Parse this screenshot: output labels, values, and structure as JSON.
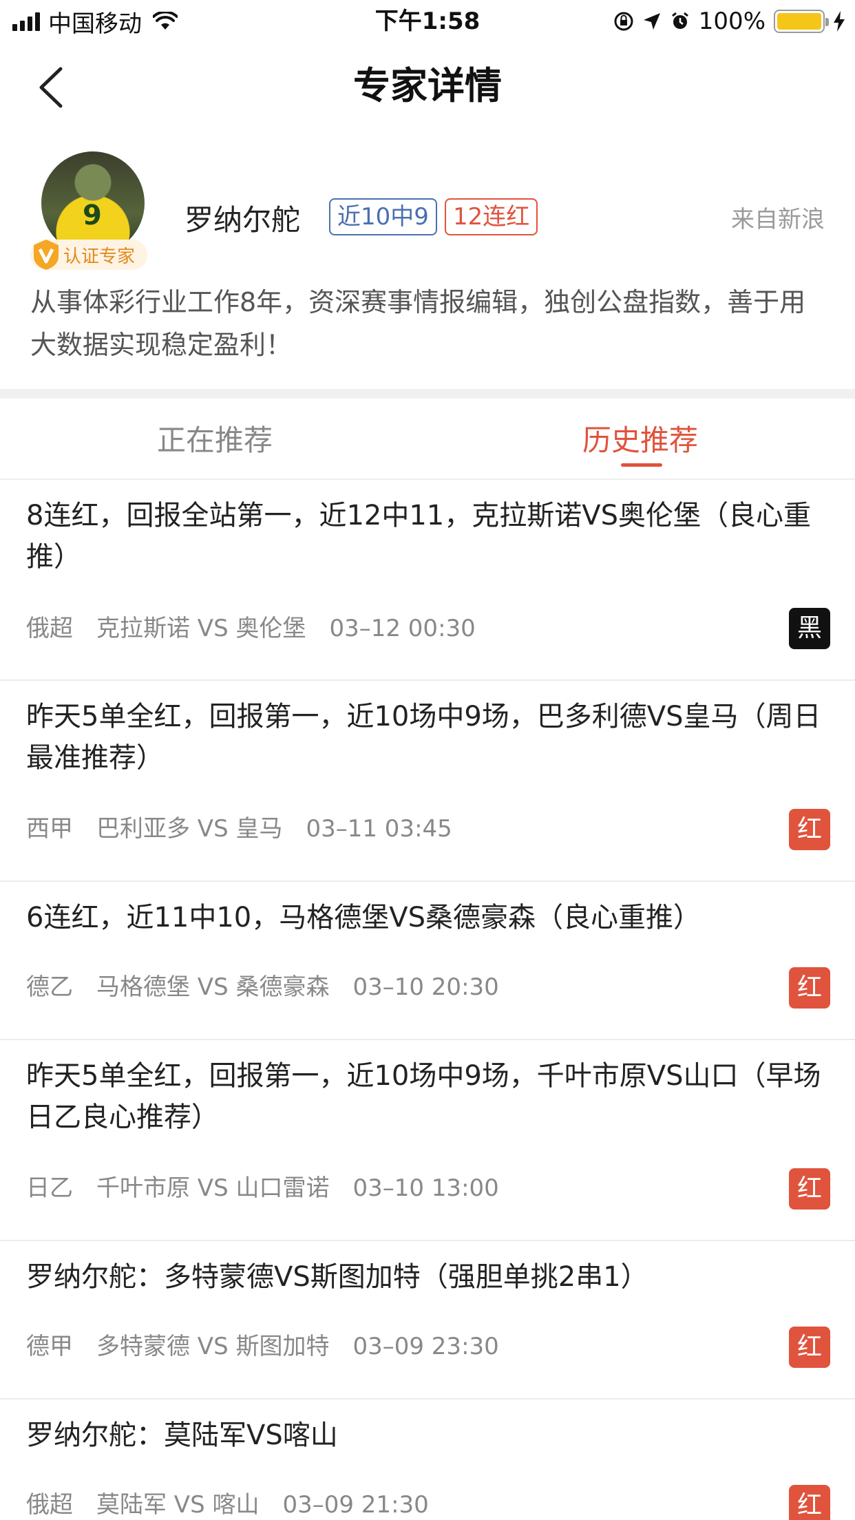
{
  "status_bar": {
    "carrier": "中国移动",
    "time": "下午1:58",
    "battery": "100%",
    "battery_level": 1.0
  },
  "nav": {
    "title": "专家详情",
    "back_icon": "chevron-left-icon"
  },
  "expert": {
    "name": "罗纳尔舵",
    "badge_label": "认证专家",
    "tag_hit_rate": "近10中9",
    "tag_streak": "12连红",
    "source": "来自新浪",
    "description": "从事体彩行业工作8年，资深赛事情报编辑，独创公盘指数，善于用大数据实现稳定盈利！",
    "avatar_jersey_number": "9"
  },
  "tabs": [
    {
      "label": "正在推荐",
      "active": false
    },
    {
      "label": "历史推荐",
      "active": true
    }
  ],
  "colors": {
    "accent": "#e0533d",
    "tag_blue": "#4a6fb0",
    "cert_orange": "#e08a1e",
    "black_badge": "#111111"
  },
  "items": [
    {
      "title": "8连红，回报全站第一，近12中11，克拉斯诺VS奥伦堡（良心重推）",
      "league": "俄超",
      "match": "克拉斯诺 VS 奥伦堡",
      "time": "03–12 00:30",
      "result": "黑",
      "result_type": "black"
    },
    {
      "title": "昨天5单全红，回报第一，近10场中9场，巴多利德VS皇马（周日最准推荐）",
      "league": "西甲",
      "match": "巴利亚多 VS 皇马",
      "time": "03–11 03:45",
      "result": "红",
      "result_type": "red"
    },
    {
      "title": "6连红，近11中10，马格德堡VS桑德豪森（良心重推）",
      "league": "德乙",
      "match": "马格德堡 VS 桑德豪森",
      "time": "03–10 20:30",
      "result": "红",
      "result_type": "red"
    },
    {
      "title": "昨天5单全红，回报第一，近10场中9场，千叶市原VS山口（早场日乙良心推荐）",
      "league": "日乙",
      "match": "千叶市原 VS 山口雷诺",
      "time": "03–10 13:00",
      "result": "红",
      "result_type": "red"
    },
    {
      "title": "罗纳尔舵：多特蒙德VS斯图加特（强胆单挑2串1）",
      "league": "德甲",
      "match": "多特蒙德 VS 斯图加特",
      "time": "03–09 23:30",
      "result": "红",
      "result_type": "red"
    },
    {
      "title": "罗纳尔舵：莫陆军VS喀山",
      "league": "俄超",
      "match": "莫陆军 VS 喀山",
      "time": "03–09 21:30",
      "result": "红",
      "result_type": "red"
    }
  ]
}
